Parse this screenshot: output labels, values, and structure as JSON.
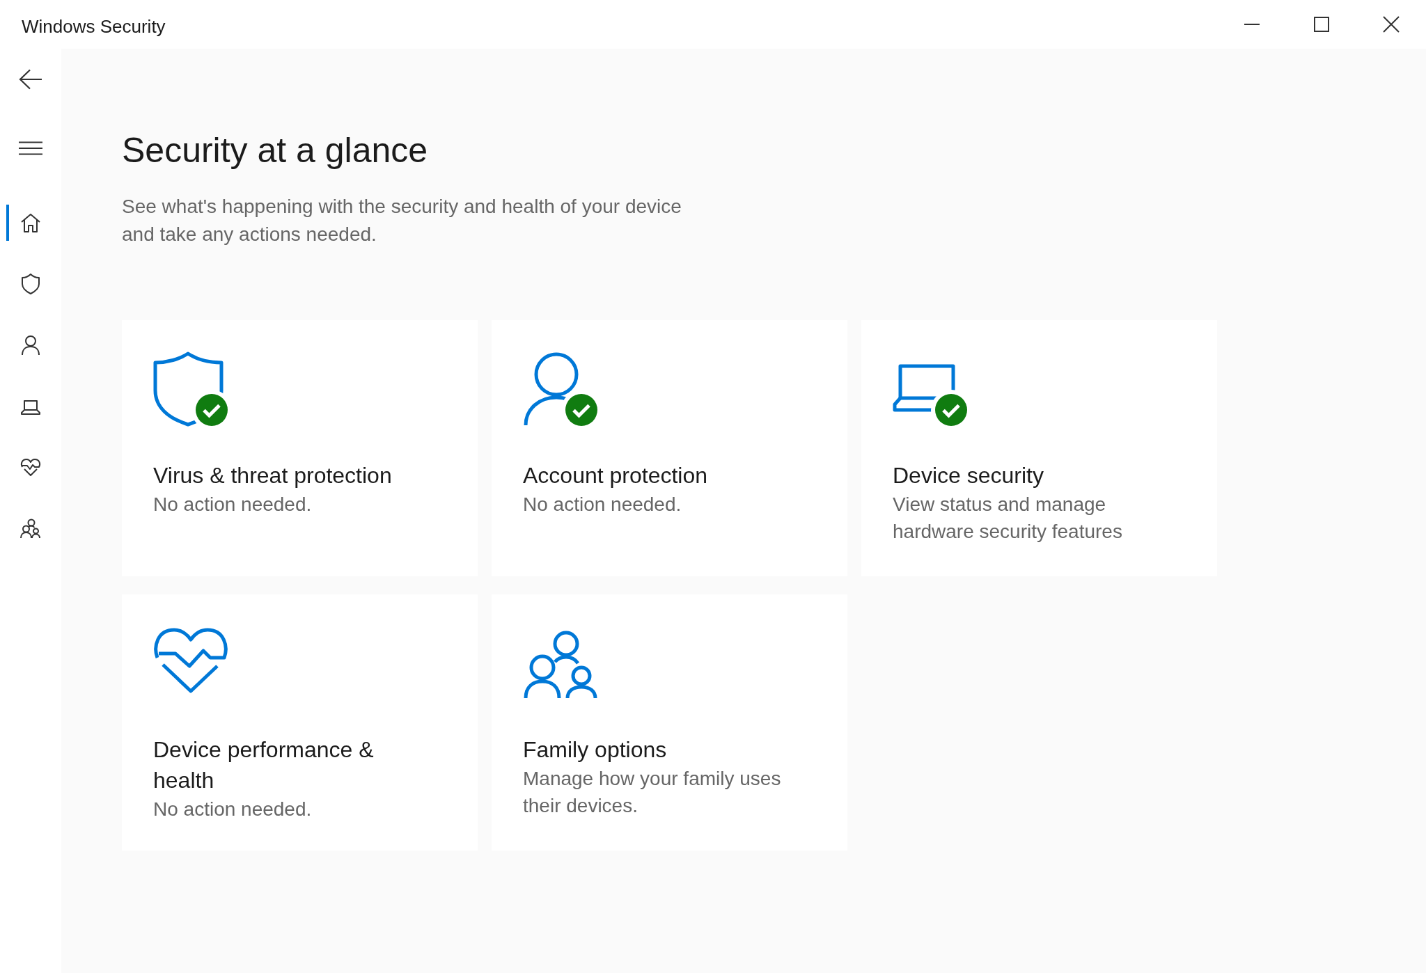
{
  "window": {
    "title": "Windows Security"
  },
  "sidebar": {
    "items": [
      {
        "selected": true
      },
      {
        "selected": false
      },
      {
        "selected": false
      },
      {
        "selected": false
      },
      {
        "selected": false
      },
      {
        "selected": false
      }
    ]
  },
  "page": {
    "heading": "Security at a glance",
    "description": "See what's happening with the security and health of your device and take any actions needed."
  },
  "cards": [
    {
      "title": "Virus & threat protection",
      "subtitle": "No action needed.",
      "ok": true
    },
    {
      "title": "Account protection",
      "subtitle": "No action needed.",
      "ok": true
    },
    {
      "title": "Device security",
      "subtitle": "View status and manage hardware security features",
      "ok": true
    },
    {
      "title": "Device performance & health",
      "subtitle": "No action needed.",
      "ok": false
    },
    {
      "title": "Family options",
      "subtitle": "Manage how your family uses their devices.",
      "ok": false
    }
  ]
}
